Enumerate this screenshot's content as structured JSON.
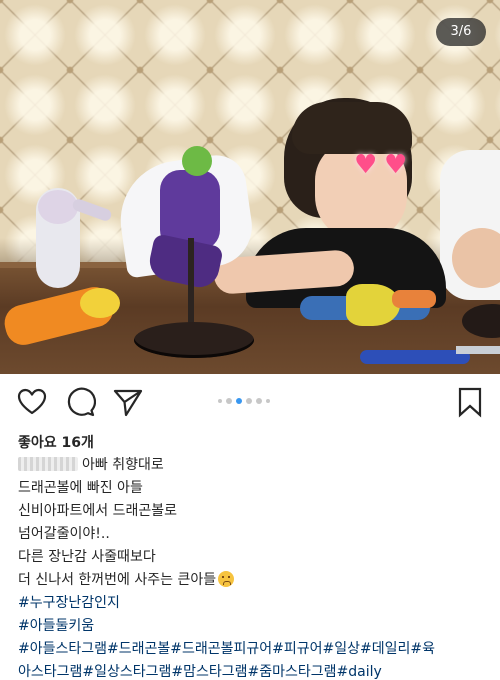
{
  "photo": {
    "page_counter": "3/6",
    "description_icons": [
      "heart-emoji",
      "heart-emoji"
    ]
  },
  "actions": {
    "like_icon": "heart-outline-icon",
    "comment_icon": "speech-bubble-icon",
    "share_icon": "paper-plane-icon",
    "save_icon": "bookmark-icon",
    "carousel_dots": 6,
    "carousel_active_index": 3,
    "accent_color": "#3897f0"
  },
  "likes": "좋아요 16개",
  "caption": {
    "line1_suffix": "아빠 취향대로",
    "line2": "드래곤볼에 빠진 아들",
    "line3": "신비아파트에서 드래곤볼로",
    "line4": "넘어갈줄이야!..",
    "line5": "다른 장난감 사줄때보다",
    "line6": "더 신나서 한꺼번에 사주는 큰아들",
    "hashtag1": "#누구장난감인지",
    "hashtag2": "#아들둘키움",
    "hashtag3": "#아들스타그램#드래곤볼#드래곤볼피규어#피규어#일상#데일리#육",
    "hashtag4": "아스타그램#일상스타그램#맘스타그램#줌마스타그램#daily"
  },
  "colors": {
    "text": "#262626",
    "hashtag": "#003569"
  }
}
